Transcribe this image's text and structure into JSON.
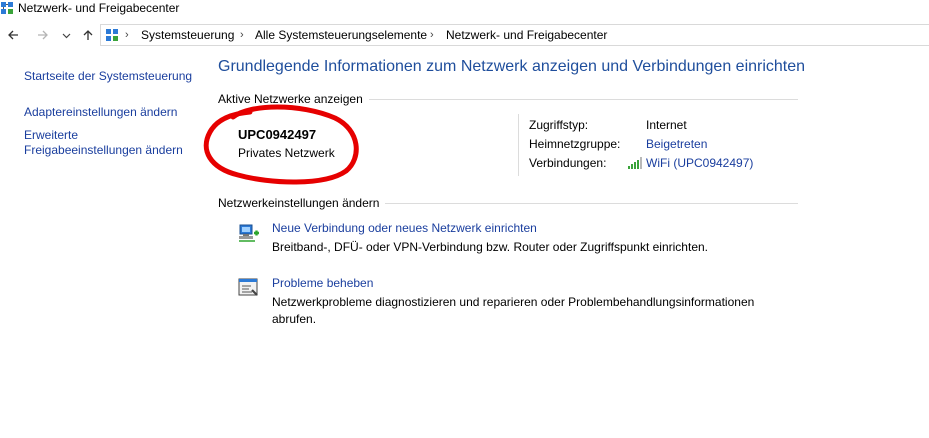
{
  "window": {
    "title": "Netzwerk- und Freigabecenter"
  },
  "nav": {
    "back_icon": "back-arrow-icon",
    "forward_icon": "forward-arrow-icon",
    "recent_icon": "chevron-down-icon",
    "up_icon": "up-arrow-icon",
    "breadcrumbs": [
      "Systemsteuerung",
      "Alle Systemsteuerungselemente",
      "Netzwerk- und Freigabecenter"
    ],
    "separator": "›"
  },
  "sidebar": {
    "items": [
      {
        "label": "Startseite der Systemsteuerung"
      },
      {
        "label": "Adaptereinstellungen ändern"
      },
      {
        "label_line1": "Erweiterte",
        "label_line2": "Freigabeeinstellungen ändern"
      }
    ]
  },
  "main": {
    "heading": "Grundlegende Informationen zum Netzwerk anzeigen und Verbindungen einrichten",
    "active_networks": {
      "section_label": "Aktive Netzwerke anzeigen",
      "network_name": "UPC0942497",
      "network_type": "Privates Netzwerk",
      "access_type_label": "Zugriffstyp:",
      "access_type_value": "Internet",
      "homegroup_label": "Heimnetzgruppe:",
      "homegroup_value": "Beigetreten",
      "connections_label": "Verbindungen:",
      "connections_value": "WiFi (UPC0942497)",
      "connections_icon": "wifi-signal-icon"
    },
    "change_settings": {
      "section_label": "Netzwerkeinstellungen ändern",
      "tasks": [
        {
          "icon": "new-connection-icon",
          "title": "Neue Verbindung oder neues Netzwerk einrichten",
          "description": "Breitband-, DFÜ- oder VPN-Verbindung bzw. Router oder Zugriffspunkt einrichten."
        },
        {
          "icon": "troubleshoot-icon",
          "title": "Probleme beheben",
          "description_line1": "Netzwerkprobleme diagnostizieren und reparieren oder Problembehandlungsinformationen",
          "description_line2": "abrufen."
        }
      ]
    }
  },
  "colors": {
    "link": "#1a3e9e",
    "heading": "#1f4e9c",
    "annotation": "#e60000"
  }
}
